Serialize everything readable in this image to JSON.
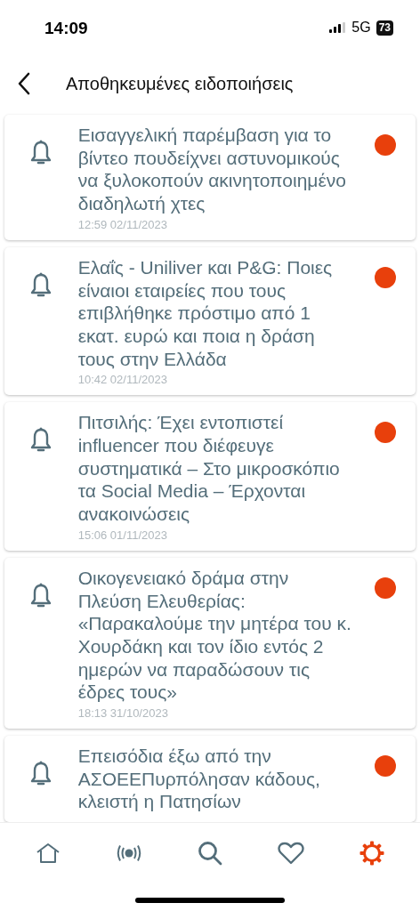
{
  "status_bar": {
    "time": "14:09",
    "network": "5G",
    "battery": "73"
  },
  "header": {
    "title": "Αποθηκευμένες ειδοποιήσεις"
  },
  "notifications": [
    {
      "title": "Εισαγγελική παρέμβαση για το βίντεο πουδείχνει αστυνομικούς να ξυλοκοπούν ακινητοποιημένο διαδηλωτή χτες",
      "date": "12:59 02/11/2023",
      "unread": true
    },
    {
      "title": "Ελαΐς - Uniliver και P&G: Ποιες είναιοι εταιρείες που τους επιβλήθηκε πρόστιμο από 1 εκατ. ευρώ και ποια η δράση τους στην Ελλάδα",
      "date": "10:42 02/11/2023",
      "unread": true
    },
    {
      "title": "Πιτσιλής: Έχει εντοπιστεί influencer που διέφευγε συστηματικά – Στο μικροσκόπιο τα Social Media – Έρχονται ανακοινώσεις",
      "date": "15:06 01/11/2023",
      "unread": true
    },
    {
      "title": "Οικογενειακό δράμα στην Πλεύση Ελευθερίας: «Παρακαλούμε την μητέρα του κ. Χουρδάκη και τον ίδιο εντός 2 ημερών να παραδώσουν τις έδρες τους»",
      "date": "18:13 31/10/2023",
      "unread": true
    },
    {
      "title": "Επεισόδια έξω από την ΑΣΟΕΕΠυρπόλησαν κάδους, κλειστή η Πατησίων",
      "unread": true
    }
  ],
  "tab_bar": [
    {
      "kind": "home",
      "selected": false
    },
    {
      "kind": "live",
      "selected": false
    },
    {
      "kind": "search",
      "selected": false
    },
    {
      "kind": "favorites",
      "selected": false
    },
    {
      "kind": "settings",
      "selected": true
    }
  ]
}
